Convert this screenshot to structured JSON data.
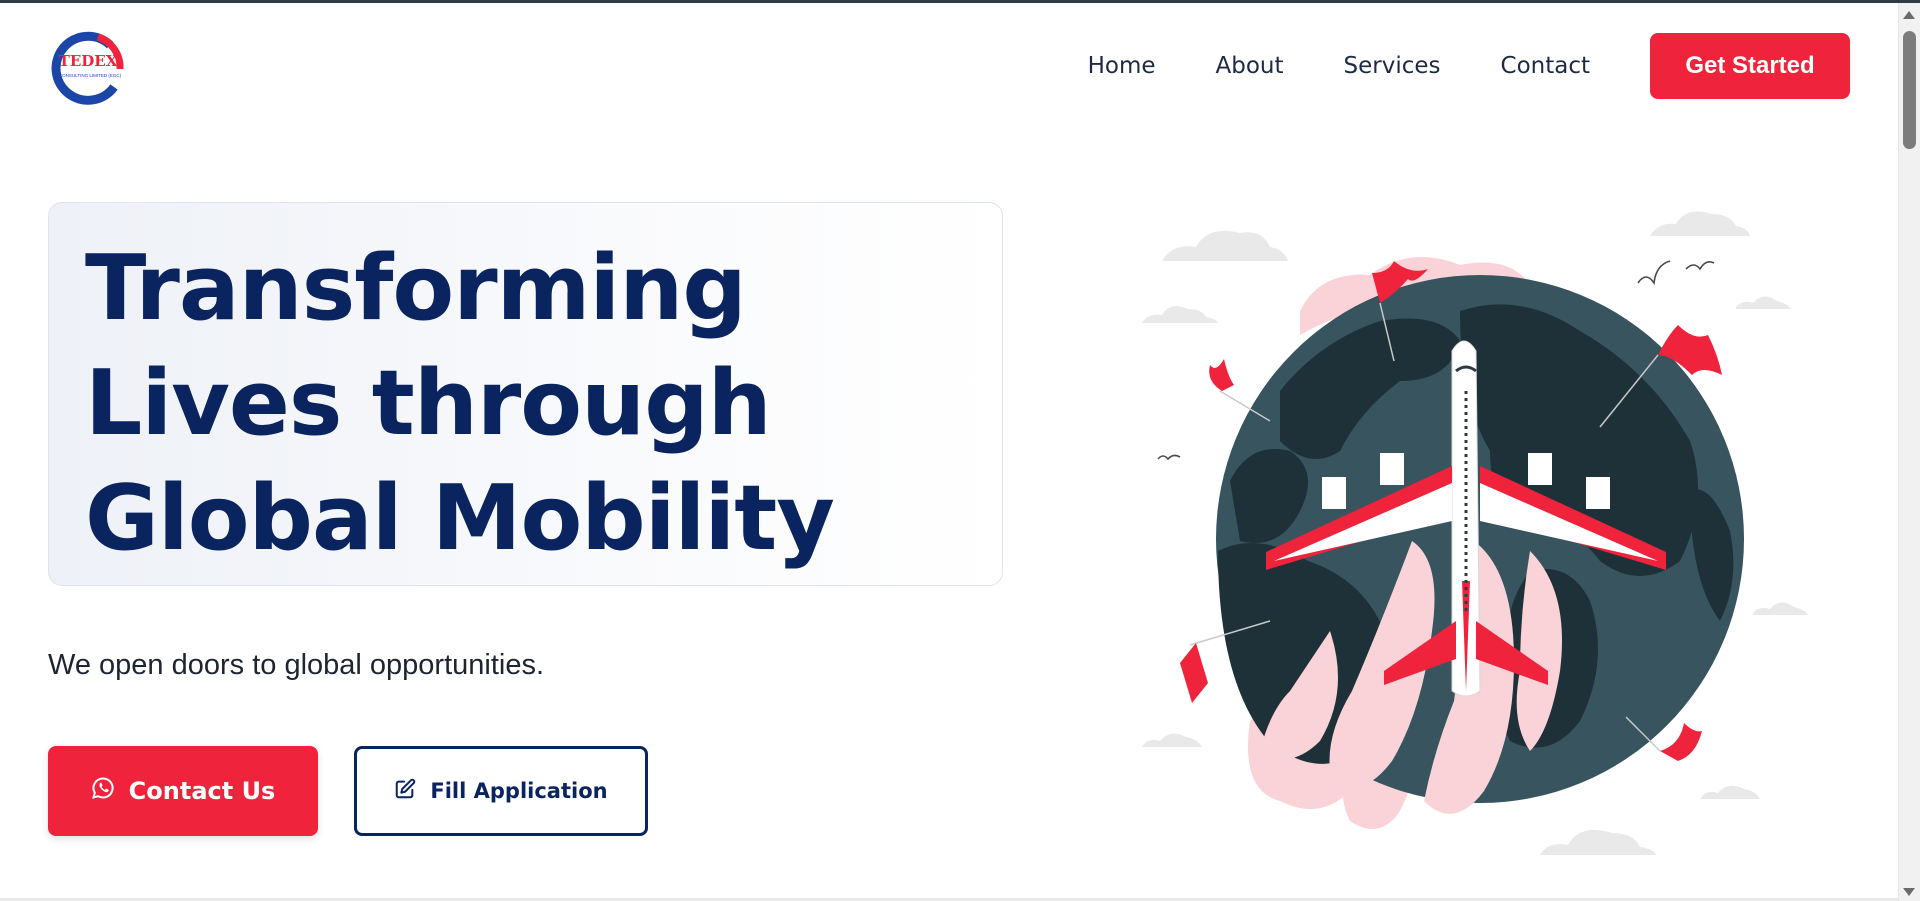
{
  "logo": {
    "text": "TEDEX",
    "subtext": "CONSULTING LIMITED (EGC)"
  },
  "nav": {
    "items": [
      {
        "label": "Home"
      },
      {
        "label": "About"
      },
      {
        "label": "Services"
      },
      {
        "label": "Contact"
      }
    ],
    "cta_label": "Get Started"
  },
  "hero": {
    "title_lines": [
      "Transforming",
      "Lives through",
      "Global Mobility"
    ],
    "tagline": "We open doors to global opportunities.",
    "primary_button": {
      "label": "Contact Us",
      "icon": "whatsapp-icon"
    },
    "secondary_button": {
      "label": "Fill Application",
      "icon": "edit-icon"
    }
  },
  "colors": {
    "brand_red": "#ef233c",
    "brand_navy": "#0a2460",
    "globe": "#37545f",
    "land": "#1f3138",
    "smoke": "#f9d3d7"
  }
}
